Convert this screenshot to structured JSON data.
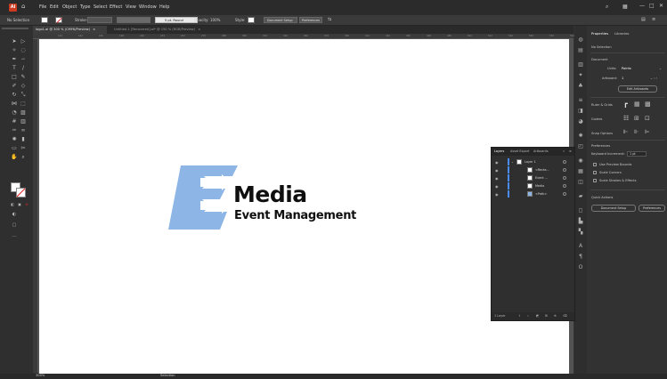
{
  "app": {
    "logo_label": "Ai"
  },
  "menu": [
    "File",
    "Edit",
    "Object",
    "Type",
    "Select",
    "Effect",
    "View",
    "Window",
    "Help"
  ],
  "control_bar": {
    "selection_label": "No Selection",
    "stroke_label": "Stroke:",
    "brush_label": "5 pt. Round",
    "opacity_label": "Opacity:",
    "opacity_value": "100%",
    "style_label": "Style:",
    "document_setup": "Document Setup",
    "preferences": "Preferences"
  },
  "tabs": [
    {
      "label": "logo1.ai @ 300 % (CMYK/Preview)",
      "close": "×"
    },
    {
      "label": "Untitled-1 [Recovered].ai* @ 150 % (RGB/Preview)",
      "close": "×"
    }
  ],
  "ruler_ticks": [
    "144",
    "162",
    "180",
    "198",
    "216",
    "234",
    "252",
    "270",
    "288",
    "306",
    "324",
    "342",
    "360",
    "378",
    "396",
    "414",
    "432",
    "450",
    "468",
    "486",
    "504",
    "522",
    "540",
    "558",
    "576",
    "594"
  ],
  "properties": {
    "tab_properties": "Properties",
    "tab_libraries": "Libraries",
    "no_selection": "No Selection",
    "document_header": "Document",
    "units_label": "Units:",
    "units_value": "Points",
    "artboard_label": "Artboard:",
    "artboard_value": "1",
    "edit_artboards": "Edit Artboards",
    "ruler_grids": "Ruler & Grids",
    "guides": "Guides",
    "snap_options": "Snap Options",
    "preferences_header": "Preferences",
    "keyboard_increment_label": "Keyboard Increment:",
    "keyboard_increment_value": "1 pt",
    "use_preview_bounds": "Use Preview Bounds",
    "scale_corners": "Scale Corners",
    "scale_strokes": "Scale Strokes & Effects",
    "quick_actions": "Quick Actions",
    "document_setup_btn": "Document Setup",
    "preferences_btn": "Preferences"
  },
  "layers_panel": {
    "tabs": [
      "Layers",
      "Asset Export",
      "Artboards"
    ],
    "rows": [
      {
        "name": "Layer 1",
        "indent": 0
      },
      {
        "name": "<Recta...",
        "indent": 1
      },
      {
        "name": "Event ...",
        "indent": 1
      },
      {
        "name": "Media",
        "indent": 1
      },
      {
        "name": "<Path>",
        "indent": 1
      }
    ],
    "footer_label": "1 Layer"
  },
  "artwork": {
    "title": "Media",
    "subtitle": "Event Management",
    "mark_color": "#8db6e6",
    "text_color": "#0f0f0f"
  },
  "status_bar": {
    "zoom": "300%",
    "tool": "Selection"
  }
}
